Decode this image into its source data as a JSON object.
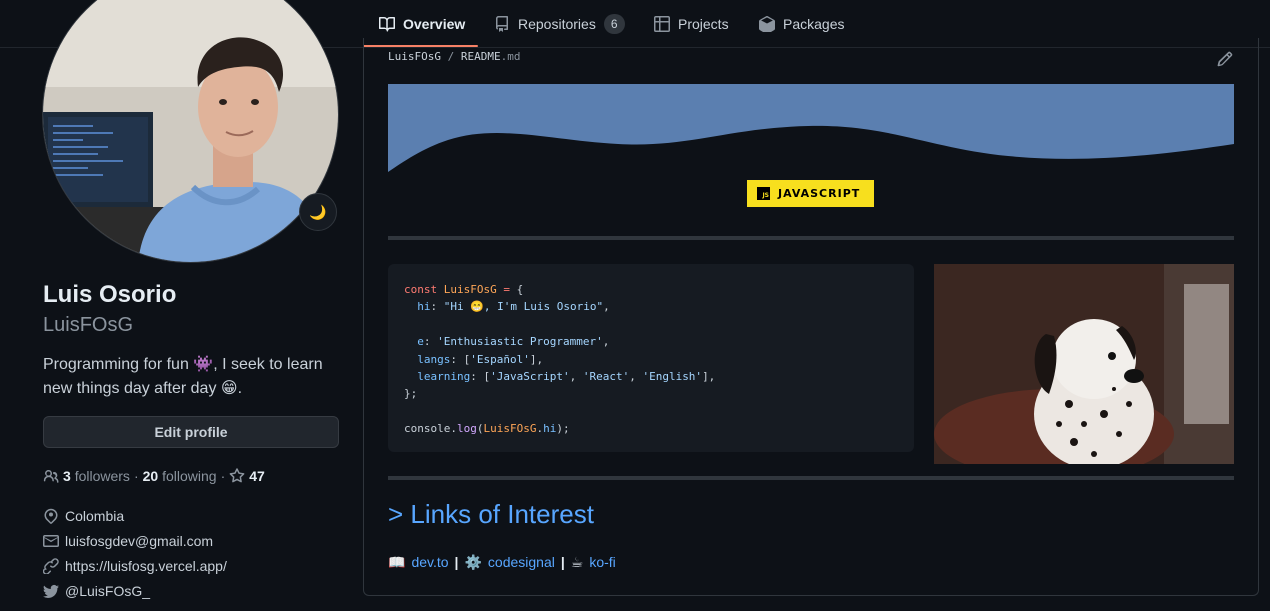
{
  "tabs": [
    {
      "label": "Overview",
      "icon": "book-icon",
      "active": true
    },
    {
      "label": "Repositories",
      "icon": "repo-icon",
      "count": "6"
    },
    {
      "label": "Projects",
      "icon": "table-icon"
    },
    {
      "label": "Packages",
      "icon": "package-icon"
    }
  ],
  "profile": {
    "name": "Luis Osorio",
    "login": "LuisFOsG",
    "status_emoji": "🌙",
    "bio": "Programming for fun 👾, I seek to learn new things day after day 😁.",
    "edit_label": "Edit profile",
    "followers_count": "3",
    "followers_label": "followers",
    "following_count": "20",
    "following_label": "following",
    "stars_count": "47",
    "location": "Colombia",
    "email": "luisfosgdev@gmail.com",
    "website": "https://luisfosg.vercel.app/",
    "twitter": "@LuisFOsG_"
  },
  "readme": {
    "path_user": "LuisFOsG",
    "path_sep": "/",
    "path_file": "README",
    "path_ext": ".md",
    "badge_label": "JAVASCRIPT",
    "badge_logo": "JS",
    "links_heading": "> Links of Interest",
    "links": [
      {
        "emoji": "📖",
        "label": "dev.to"
      },
      {
        "emoji": "⚙️",
        "label": "codesignal"
      },
      {
        "emoji": "☕",
        "label": "ko-fi"
      }
    ],
    "link_separator": "|"
  },
  "colors": {
    "background": "#0d1117",
    "accent_link": "#58a6ff",
    "tab_underline": "#f78166",
    "wave": "#5b7fb0",
    "badge": "#f7df1e"
  }
}
